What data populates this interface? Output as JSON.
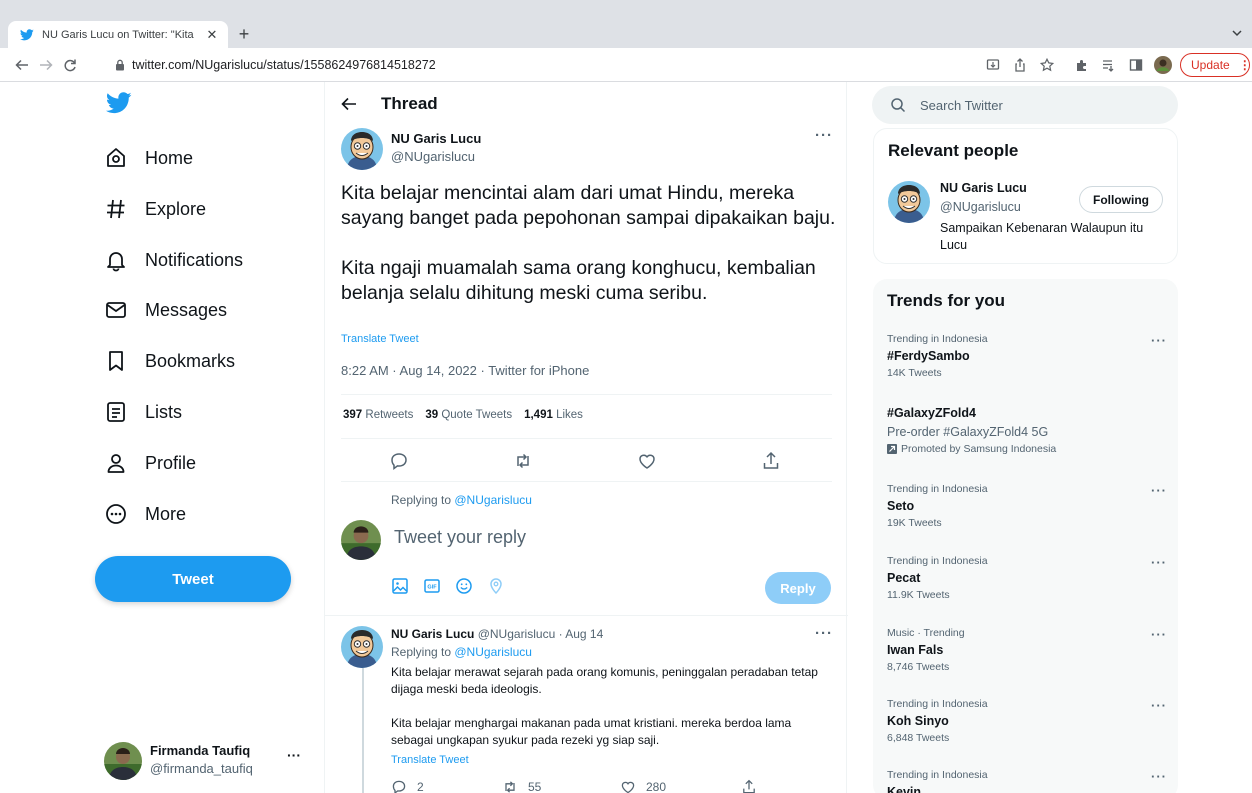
{
  "browser": {
    "tab_title": "NU Garis Lucu on Twitter: \"Kita",
    "url": "twitter.com/NUgarislucu/status/1558624976814518272",
    "update_label": "Update"
  },
  "sidebar": {
    "items": [
      {
        "label": "Home",
        "icon": "home-icon"
      },
      {
        "label": "Explore",
        "icon": "hashtag-icon"
      },
      {
        "label": "Notifications",
        "icon": "bell-icon"
      },
      {
        "label": "Messages",
        "icon": "envelope-icon"
      },
      {
        "label": "Bookmarks",
        "icon": "bookmark-icon"
      },
      {
        "label": "Lists",
        "icon": "list-icon"
      },
      {
        "label": "Profile",
        "icon": "person-icon"
      },
      {
        "label": "More",
        "icon": "more-circle-icon"
      }
    ],
    "tweet_button": "Tweet",
    "account": {
      "name": "Firmanda Taufiq",
      "handle": "@firmanda_taufiq"
    }
  },
  "thread": {
    "title": "Thread",
    "author": {
      "name": "NU Garis Lucu",
      "handle": "@NUgarislucu"
    },
    "body_p1": "Kita belajar mencintai alam dari umat Hindu, mereka sayang banget pada pepohonan sampai dipakaikan baju.",
    "body_p2": "Kita ngaji muamalah sama orang konghucu, kembalian belanja selalu dihitung meski cuma seribu.",
    "translate": "Translate Tweet",
    "meta": "8:22 AM · Aug 14, 2022 · Twitter for iPhone",
    "stats": {
      "retweets_count": "397",
      "retweets_label": "Retweets",
      "quotes_count": "39",
      "quotes_label": "Quote Tweets",
      "likes_count": "1,491",
      "likes_label": "Likes"
    },
    "replying_prefix": "Replying to ",
    "replying_handle": "@NUgarislucu",
    "reply_placeholder": "Tweet your reply",
    "reply_button": "Reply"
  },
  "reply_tweet": {
    "name": "NU Garis Lucu",
    "handle_date": "@NUgarislucu · Aug 14",
    "replying_prefix": "Replying to ",
    "replying_handle": "@NUgarislucu",
    "body_p1": "Kita belajar merawat sejarah pada orang komunis, peninggalan peradaban tetap dijaga meski beda ideologis.",
    "body_p2": "Kita belajar menghargai makanan pada umat kristiani. mereka berdoa lama sebagai ungkapan syukur pada rezeki yg siap saji.",
    "translate": "Translate Tweet",
    "replies": "2",
    "retweets": "55",
    "likes": "280"
  },
  "right": {
    "search_placeholder": "Search Twitter",
    "relevant_title": "Relevant people",
    "relevant": {
      "name": "NU Garis Lucu",
      "handle": "@NUgarislucu",
      "bio": "Sampaikan Kebenaran Walaupun itu Lucu",
      "button": "Following"
    },
    "trends_title": "Trends for you",
    "trends": [
      {
        "context": "Trending in Indonesia",
        "name": "#FerdySambo",
        "count": "14K Tweets"
      },
      {
        "context": "",
        "name": "#GalaxyZFold4",
        "subtitle": "Pre-order #GalaxyZFold4 5G",
        "promoted": "Promoted by Samsung Indonesia"
      },
      {
        "context": "Trending in Indonesia",
        "name": "Seto",
        "count": "19K Tweets"
      },
      {
        "context": "Trending in Indonesia",
        "name": "Pecat",
        "count": "11.9K Tweets"
      },
      {
        "context": "Music · Trending",
        "name": "Iwan Fals",
        "count": "8,746 Tweets"
      },
      {
        "context": "Trending in Indonesia",
        "name": "Koh Sinyo",
        "count": "6,848 Tweets"
      },
      {
        "context": "Trending in Indonesia",
        "name": "Kevin"
      }
    ]
  },
  "colors": {
    "accent": "#1d9bf0",
    "update": "#d93025",
    "reply_disabled": "#8ecdf8"
  }
}
